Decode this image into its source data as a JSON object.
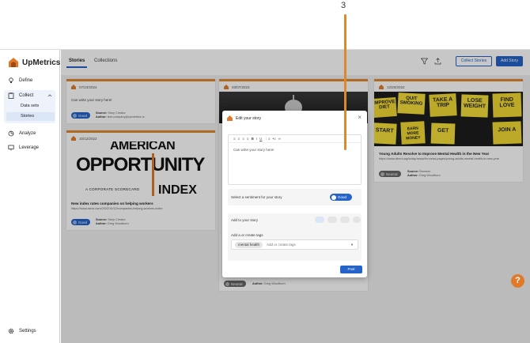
{
  "callout": {
    "number": "3"
  },
  "brand": {
    "name": "UpMetrics"
  },
  "sidebar": {
    "define": "Define",
    "collect": "Collect",
    "data_sets": "Data sets",
    "stories": "Stories",
    "analyze": "Analyze",
    "leverage": "Leverage",
    "settings": "Settings"
  },
  "tabs": {
    "stories": "Stories",
    "collections": "Collections"
  },
  "toolbar": {
    "collect_stories": "Collect Stories",
    "add_story": "Add Story"
  },
  "cards": [
    {
      "date": "07/23/2024",
      "text": "Can write your story here!",
      "sentiment": "Good",
      "source_label": "Source:",
      "source": "Story Creator",
      "author_label": "Author:",
      "author": "test.company@upmetrics.io"
    },
    {
      "date": "10/12/2022",
      "image_text": {
        "line1": "AMERICAN",
        "line2": "OPPORTUNITY",
        "line3": "A CORPORATE SCORECARD",
        "line4": "INDEX"
      },
      "title": "New index rates companies on helping workers",
      "link": "https://www.axios.com/2022/10/12/companies-helping-workers-index",
      "sentiment": "Good",
      "source_label": "Source:",
      "source": "Story Creator",
      "author_label": "Author:",
      "author": "Greg Woodburn"
    },
    {
      "date": "03/07/2023"
    },
    {
      "date": "12/20/2022",
      "image_notes": [
        "IMPROVE DIET",
        "QUIT SMOKING",
        "TAKE A TRIP",
        "LOSE WEIGHT",
        "FIND LOVE",
        "START",
        "EARN MORE MONEY",
        "GET",
        "JOIN A"
      ],
      "title": "Young Adults Resolve to Improve Mental Health in the New Year",
      "link": "https://www.direct.org/today/news/for-news-pages/young-adults-mental-health-in-new-year",
      "sentiment": "Neutral",
      "source_label": "Source:",
      "source": "Browser",
      "author_label": "Author:",
      "author": "Greg Woodburn"
    },
    {
      "sentiment": "Neutral",
      "author_label": "Author:",
      "author": "Greg Woodburn"
    }
  ],
  "modal": {
    "title": "Edit your story",
    "close": "×",
    "editor_text": "Can write your story here!",
    "sentiment_label": "Select a sentiment for your story",
    "sentiment_value": "Good",
    "add_label": "Add to your story",
    "tags_label": "Add a or create tags",
    "tag_chip": "mental health",
    "tag_placeholder": "Add or create tags",
    "post": "Post"
  },
  "help": {
    "label": "?"
  },
  "colors": {
    "accent": "#2563c9",
    "brand_orange": "#e07a2a"
  }
}
